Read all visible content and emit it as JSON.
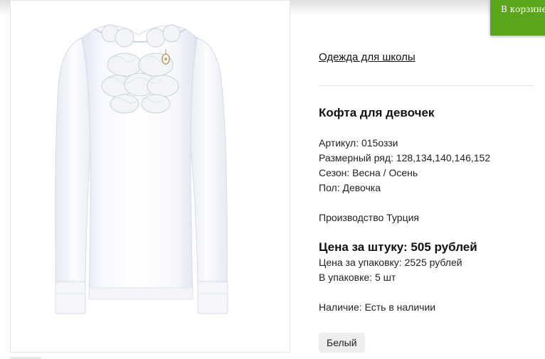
{
  "cart": {
    "label": "В корзине"
  },
  "product": {
    "image_alt": "Кофта для девочек",
    "category_link": "Одежда для школы",
    "title": "Кофта для девочек",
    "specs": [
      "Артикул: 015оззи",
      "Размерный ряд: 128,134,140,146,152",
      "Сезон: Весна / Осень",
      "Пол: Девочка"
    ],
    "origin": "Производство Турция",
    "price_per_item": "Цена за штуку: 505 рублей",
    "price_per_pack": "Цена за упаковку: 2525 рублей",
    "pack_size": "В упаковке: 5 шт",
    "availability": "Наличие: Есть в наличии",
    "color_option": "Белый"
  },
  "colors": {
    "accent": "#5aa51a",
    "shirt": "#ffffff",
    "shirt_shade": "#e7ecf5"
  }
}
